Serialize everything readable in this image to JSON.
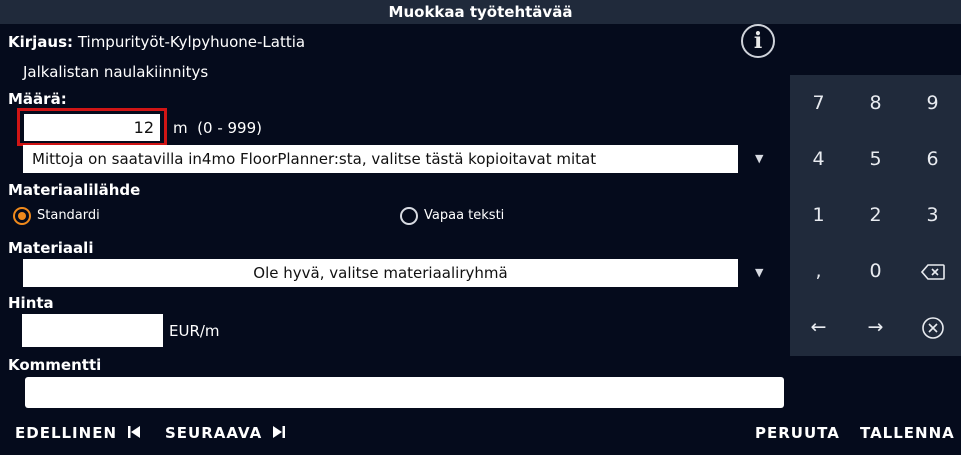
{
  "window": {
    "title": "Muokkaa työtehtävää"
  },
  "booking": {
    "label": "Kirjaus:",
    "value": "Timpurityöt-Kylpyhuone-Lattia"
  },
  "task": {
    "description": "Jalkalistan naulakiinnitys"
  },
  "quantity": {
    "label": "Määrä:",
    "value": "12",
    "unit": "m",
    "range": "(0 - 999)"
  },
  "measure_select": {
    "selected": "Mittoja on saatavilla in4mo FloorPlanner:sta, valitse tästä kopioitavat mitat"
  },
  "material_source": {
    "label": "Materiaalilähde",
    "options": [
      {
        "label": "Standardi",
        "selected": true
      },
      {
        "label": "Vapaa teksti",
        "selected": false
      }
    ]
  },
  "material": {
    "label": "Materiaali",
    "selected": "Ole hyvä, valitse materiaaliryhmä"
  },
  "price": {
    "label": "Hinta",
    "value": "",
    "unit": "EUR/m"
  },
  "comment": {
    "label": "Kommentti",
    "value": ""
  },
  "keypad": {
    "keys": [
      "7",
      "8",
      "9",
      "4",
      "5",
      "6",
      "1",
      "2",
      "3",
      ",",
      "0"
    ],
    "icons": [
      "backspace-icon",
      "arrow-left-icon",
      "arrow-right-icon",
      "close-circle-icon"
    ],
    "left_arrow": "←",
    "right_arrow": "→"
  },
  "footer": {
    "prev_label": "EDELLINEN",
    "next_label": "SEURAAVA",
    "cancel_label": "PERUUTA",
    "save_label": "TALLENNA"
  },
  "colors": {
    "background": "#050b1c",
    "panel": "#202a3b",
    "accent": "#f08a1c",
    "highlight": "#d01515"
  }
}
